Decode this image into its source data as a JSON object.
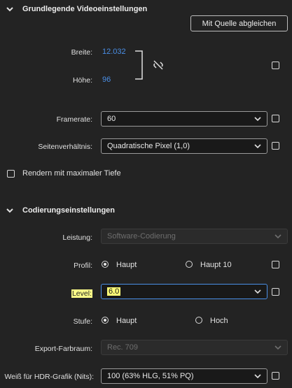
{
  "basic": {
    "title": "Grundlegende Videoeinstellungen",
    "match_source_button": "Mit Quelle abgleichen",
    "width_label": "Breite:",
    "width_value": "12.032",
    "height_label": "Höhe:",
    "height_value": "96",
    "framerate_label": "Framerate:",
    "framerate_value": "60",
    "aspect_label": "Seitenverhältnis:",
    "aspect_value": "Quadratische Pixel (1,0)",
    "max_depth_label": "Rendern mit maximaler Tiefe"
  },
  "encoding": {
    "title": "Codierungseinstellungen",
    "performance_label": "Leistung:",
    "performance_value": "Software-Codierung",
    "profile_label": "Profil:",
    "profile_options": [
      "Haupt",
      "Haupt 10"
    ],
    "level_label": "Level:",
    "level_value": "6.0",
    "tier_label": "Stufe:",
    "tier_options": [
      "Haupt",
      "Hoch"
    ],
    "export_color_label": "Export-Farbraum:",
    "export_color_value": "Rec. 709",
    "hdr_white_label": "Weiß für HDR-Grafik (Nits):",
    "hdr_white_value": "100 (63% HLG, 51% PQ)"
  },
  "colors": {
    "background": "#232323",
    "accent_blue": "#4a8fe7",
    "highlight_yellow": "#ffff88"
  }
}
